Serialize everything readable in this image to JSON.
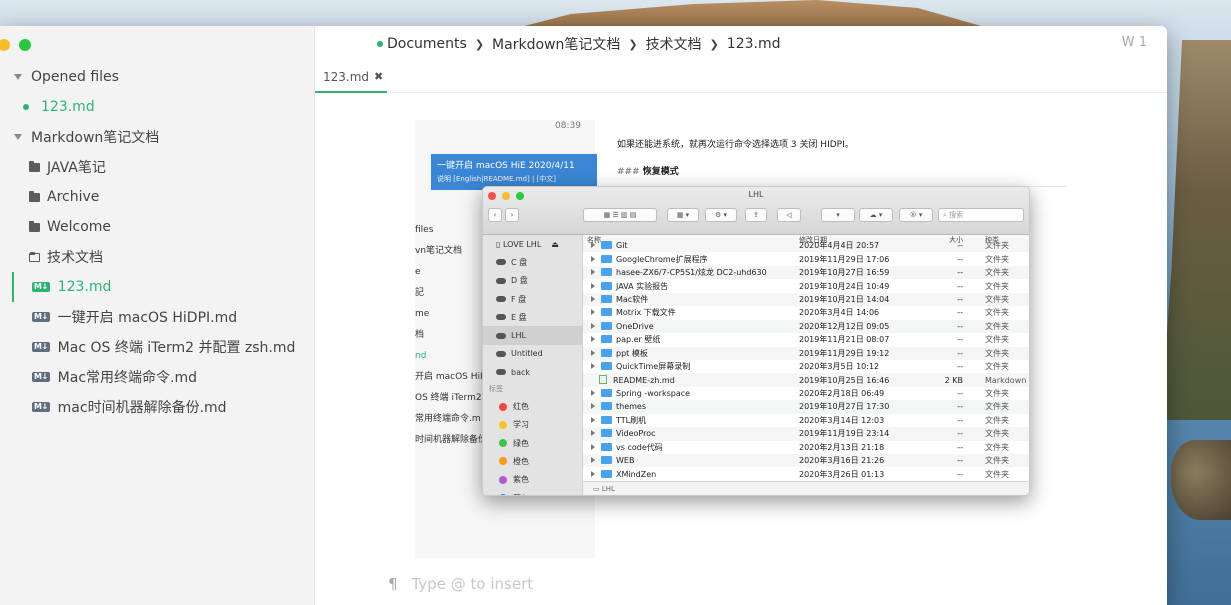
{
  "breadcrumb": {
    "items": [
      "Documents",
      "Markdown笔记文档",
      "技术文档",
      "123.md"
    ],
    "word_count": "W 1"
  },
  "tab": {
    "label": "123.md",
    "close": "✖"
  },
  "sidebar": {
    "opened_files_label": "Opened files",
    "opened_file": "123.md",
    "project_label": "Markdown笔记文档",
    "folders": [
      "JAVA笔记",
      "Archive",
      "Welcome"
    ],
    "open_folder": "技术文档",
    "files": [
      "123.md",
      "一键开启 macOS HiDPI.md",
      "Mac OS 终端 iTerm2 并配置 zsh.md",
      "Mac常用终端命令.md",
      "mac时间机器解除备份.md"
    ],
    "md_badge": "M↓"
  },
  "editor": {
    "placeholder": "Type @ to insert",
    "pilcrow": "¶"
  },
  "embedded": {
    "time": "08:39",
    "selected_note_title": "一键开启 macOS HiE 2020/4/11",
    "selected_note_sub": "说明 [English|README.md] | [中文]",
    "paragraph": "如果还能进系统，就再次运行命令选择选项 3 关闭 HIDPI。",
    "heading_hashes": "###",
    "heading": "恢复模式",
    "peek_items": [
      "files",
      "vn笔记文档",
      "e",
      "記",
      "me",
      "档",
      "nd",
      "开启 macOS HiD",
      "OS 终端 iTerm2",
      "常用终端命令.m",
      "时间机器解除备份"
    ],
    "finder": {
      "title": "LHL",
      "search_placeholder": "搜索",
      "sidebar_items": [
        "LOVE LHL",
        "C 盘",
        "D 盘",
        "F 盘",
        "E 盘",
        "LHL",
        "Untitled",
        "back"
      ],
      "tags_header": "标签",
      "tags": [
        {
          "label": "红色",
          "color": "#f2453d"
        },
        {
          "label": "学习",
          "color": "#f4c522"
        },
        {
          "label": "绿色",
          "color": "#3fc14b"
        },
        {
          "label": "橙色",
          "color": "#f59a23"
        },
        {
          "label": "紫色",
          "color": "#b25ad3"
        },
        {
          "label": "蓝色",
          "color": "#2f7ff0"
        }
      ],
      "columns": [
        "名称",
        "修改日期",
        "大小",
        "种类"
      ],
      "rows": [
        {
          "name": "Git",
          "date": "2020年4月4日 20:57",
          "size": "--",
          "kind": "文件夹"
        },
        {
          "name": "GoogleChrome扩展程序",
          "date": "2019年11月29日 17:06",
          "size": "--",
          "kind": "文件夹"
        },
        {
          "name": "hasee-ZX6/7-CP5S1/炫龙 DC2-uhd630",
          "date": "2019年10月27日 16:59",
          "size": "--",
          "kind": "文件夹"
        },
        {
          "name": "JAVA 实验报告",
          "date": "2019年10月24日 10:49",
          "size": "--",
          "kind": "文件夹"
        },
        {
          "name": "Mac软件",
          "date": "2019年10月21日 14:04",
          "size": "--",
          "kind": "文件夹"
        },
        {
          "name": "Motrix 下载文件",
          "date": "2020年3月4日 14:06",
          "size": "--",
          "kind": "文件夹"
        },
        {
          "name": "OneDrive",
          "date": "2020年12月12日 09:05",
          "size": "--",
          "kind": "文件夹"
        },
        {
          "name": "pap.er 壁纸",
          "date": "2019年11月21日 08:07",
          "size": "--",
          "kind": "文件夹"
        },
        {
          "name": "ppt 模板",
          "date": "2019年11月29日 19:12",
          "size": "--",
          "kind": "文件夹"
        },
        {
          "name": "QuickTime屏幕录制",
          "date": "2020年3月5日 10:12",
          "size": "--",
          "kind": "文件夹"
        },
        {
          "name": "README-zh.md",
          "date": "2019年10月25日 16:46",
          "size": "2 KB",
          "kind": "Markdown"
        },
        {
          "name": "Spring -workspace",
          "date": "2020年2月18日 06:49",
          "size": "--",
          "kind": "文件夹"
        },
        {
          "name": "themes",
          "date": "2019年10月27日 17:30",
          "size": "--",
          "kind": "文件夹"
        },
        {
          "name": "TTL刷机",
          "date": "2020年3月14日 12:03",
          "size": "--",
          "kind": "文件夹"
        },
        {
          "name": "VideoProc",
          "date": "2019年11月19日 23:14",
          "size": "--",
          "kind": "文件夹"
        },
        {
          "name": "vs code代码",
          "date": "2020年2月13日 21:18",
          "size": "--",
          "kind": "文件夹"
        },
        {
          "name": "WEB",
          "date": "2020年3月16日 21:26",
          "size": "--",
          "kind": "文件夹"
        },
        {
          "name": "XMindZen",
          "date": "2020年3月26日 01:13",
          "size": "--",
          "kind": "文件夹"
        }
      ],
      "status_path": "LHL"
    }
  }
}
